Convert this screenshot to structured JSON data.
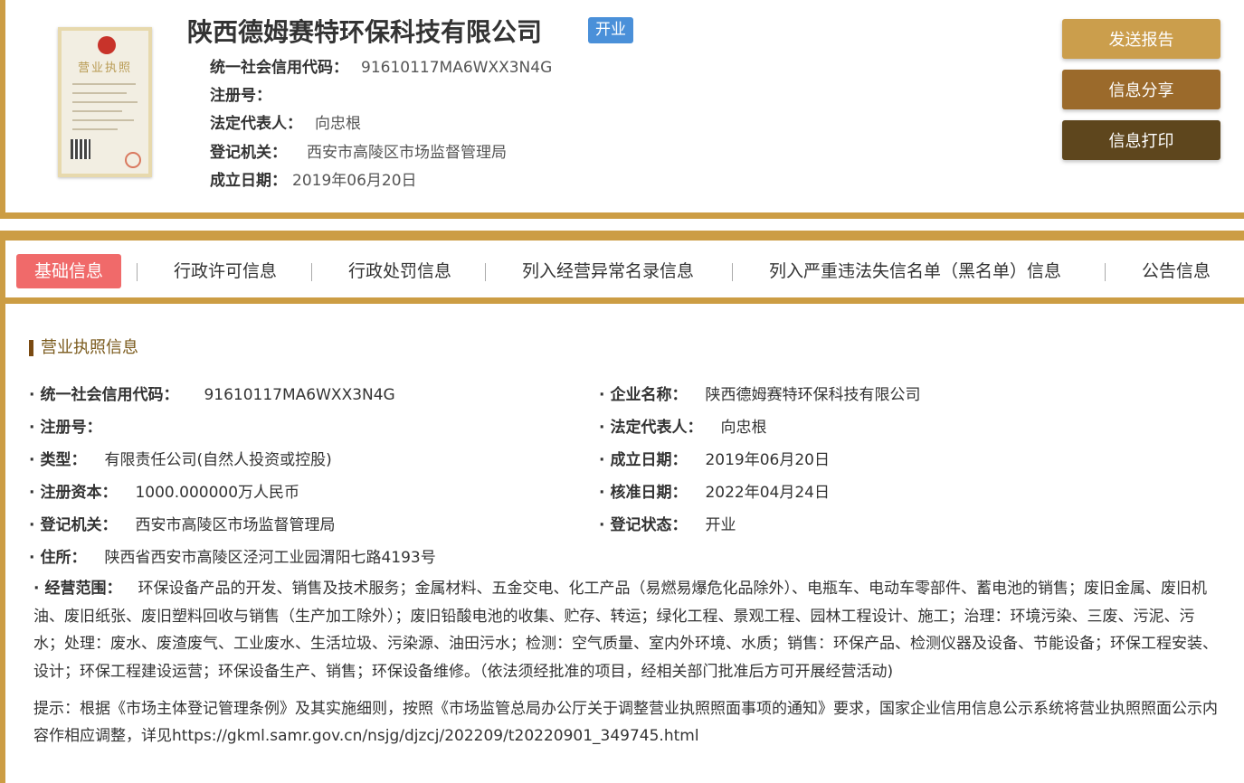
{
  "header": {
    "company_name": "陕西德姆赛特环保科技有限公司",
    "status": "开业",
    "license_image_title": "营业执照",
    "fields": [
      {
        "label": "统一社会信用代码：",
        "value": "91610117MA6WXX3N4G"
      },
      {
        "label": "注册号：",
        "value": ""
      },
      {
        "label": "法定代表人：",
        "value": "向忠根"
      },
      {
        "label": "登记机关：",
        "value": "西安市高陵区市场监督管理局"
      },
      {
        "label": "成立日期：",
        "value": "2019年06月20日"
      }
    ],
    "buttons": {
      "report": "发送报告",
      "share": "信息分享",
      "print": "信息打印"
    }
  },
  "tabs": [
    {
      "label": "基础信息",
      "active": true
    },
    {
      "label": "行政许可信息",
      "active": false
    },
    {
      "label": "行政处罚信息",
      "active": false
    },
    {
      "label": "列入经营异常名录信息",
      "active": false
    },
    {
      "label": "列入严重违法失信名单（黑名单）信息",
      "active": false
    },
    {
      "label": "公告信息",
      "active": false
    }
  ],
  "section": {
    "title": "营业执照信息",
    "left_fields": [
      {
        "label": "统一社会信用代码：",
        "value": "91610117MA6WXX3N4G"
      },
      {
        "label": "注册号：",
        "value": ""
      },
      {
        "label": "类型：",
        "value": "有限责任公司(自然人投资或控股)"
      },
      {
        "label": "注册资本：",
        "value": "1000.000000万人民币"
      },
      {
        "label": "登记机关：",
        "value": "西安市高陵区市场监督管理局"
      },
      {
        "label": "住所：",
        "value": "陕西省西安市高陵区泾河工业园渭阳七路4193号"
      }
    ],
    "right_fields": [
      {
        "label": "企业名称：",
        "value": "陕西德姆赛特环保科技有限公司"
      },
      {
        "label": "法定代表人：",
        "value": "向忠根"
      },
      {
        "label": "成立日期：",
        "value": "2019年06月20日"
      },
      {
        "label": "核准日期：",
        "value": "2022年04月24日"
      },
      {
        "label": "登记状态：",
        "value": "开业"
      }
    ],
    "scope_label": "经营范围：",
    "scope_value": "环保设备产品的开发、销售及技术服务；金属材料、五金交电、化工产品（易燃易爆危化品除外）、电瓶车、电动车零部件、蓄电池的销售；废旧金属、废旧机油、废旧纸张、废旧塑料回收与销售（生产加工除外）；废旧铅酸电池的收集、贮存、转运；绿化工程、景观工程、园林工程设计、施工；治理：环境污染、三废、污泥、污水；处理：废水、废渣废气、工业废水、生活垃圾、污染源、油田污水；检测：空气质量、室内外环境、水质；销售：环保产品、检测仪器及设备、节能设备；环保工程安装、设计；环保工程建设运营；环保设备生产、销售；环保设备维修。（依法须经批准的项目，经相关部门批准后方可开展经营活动)",
    "hint": "提示：根据《市场主体登记管理条例》及其实施细则，按照《市场监管总局办公厅关于调整营业执照照面事项的通知》要求，国家企业信用信息公示系统将营业执照照面公示内容作相应调整，详见https://gkml.samr.gov.cn/nsjg/djzcj/202209/t20220901_349745.html"
  }
}
